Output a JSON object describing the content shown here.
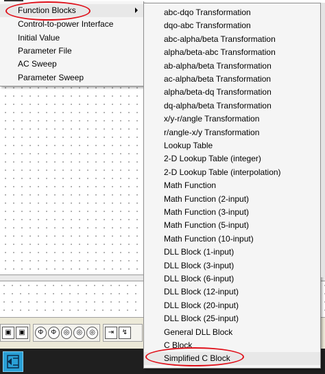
{
  "main_menu": {
    "items": [
      {
        "label": "Function Blocks",
        "has_submenu": true,
        "highlighted": true
      },
      {
        "label": "Control-to-power Interface"
      },
      {
        "label": "Initial Value"
      },
      {
        "label": "Parameter File"
      },
      {
        "label": "AC Sweep"
      },
      {
        "label": "Parameter Sweep"
      }
    ]
  },
  "submenu": {
    "items": [
      {
        "label": "abc-dqo Transformation"
      },
      {
        "label": "dqo-abc Transformation"
      },
      {
        "label": "abc-alpha/beta Transformation"
      },
      {
        "label": "alpha/beta-abc Transformation"
      },
      {
        "label": "ab-alpha/beta Transformation"
      },
      {
        "label": "ac-alpha/beta Transformation"
      },
      {
        "label": "alpha/beta-dq Transformation"
      },
      {
        "label": "dq-alpha/beta Transformation"
      },
      {
        "label": "x/y-r/angle Transformation"
      },
      {
        "label": "r/angle-x/y Transformation"
      },
      {
        "label": "Lookup Table"
      },
      {
        "label": "2-D Lookup Table (integer)"
      },
      {
        "label": "2-D Lookup Table (interpolation)"
      },
      {
        "label": "Math Function"
      },
      {
        "label": "Math Function (2-input)"
      },
      {
        "label": "Math Function (3-input)"
      },
      {
        "label": "Math Function (5-input)"
      },
      {
        "label": "Math Function (10-input)"
      },
      {
        "label": "DLL Block (1-input)"
      },
      {
        "label": "DLL Block (3-input)"
      },
      {
        "label": "DLL Block (6-input)"
      },
      {
        "label": "DLL Block (12-input)"
      },
      {
        "label": "DLL Block (20-input)"
      },
      {
        "label": "DLL Block (25-input)"
      },
      {
        "label": "General DLL Block"
      },
      {
        "label": "C Block"
      },
      {
        "label": "Simplified C Block",
        "highlighted": true
      }
    ]
  },
  "toolbar": {
    "buttons": [
      {
        "icon": "scope-icon",
        "glyph": "▣"
      },
      {
        "icon": "scope-icon-2",
        "glyph": "▣"
      },
      {
        "icon": "source-icon",
        "glyph": "Φ"
      },
      {
        "icon": "source-icon-2",
        "glyph": "Φ"
      },
      {
        "icon": "source-icon-3",
        "glyph": "◎"
      },
      {
        "icon": "source-icon-4",
        "glyph": "◎"
      },
      {
        "icon": "source-icon-5",
        "glyph": "◎"
      },
      {
        "icon": "gate-icon",
        "glyph": "⇥"
      },
      {
        "icon": "probe-icon",
        "glyph": "↯"
      }
    ]
  },
  "colors": {
    "highlight_ellipse": "#e0101a",
    "menu_bg": "#f5f5f5",
    "taskbar": "#1f1f1f",
    "app_icon": "#2aa0d6"
  }
}
